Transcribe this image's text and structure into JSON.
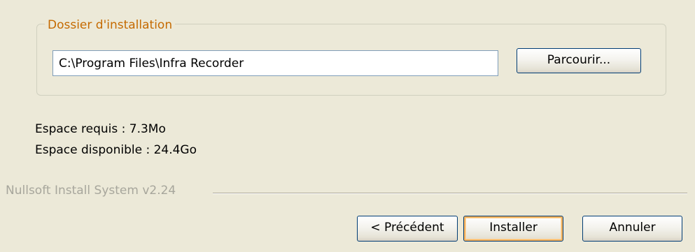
{
  "install_folder_group": {
    "label": "Dossier d'installation",
    "path_value": "C:\\Program Files\\Infra Recorder",
    "browse_label": "Parcourir..."
  },
  "space_info": {
    "required": "Espace requis : 7.3Mo",
    "available": "Espace disponible : 24.4Go"
  },
  "branding": {
    "text": "Nullsoft Install System v2.24"
  },
  "buttons": {
    "back_label": "< Précédent",
    "install_label": "Installer",
    "cancel_label": "Annuler"
  },
  "colors": {
    "background": "#ECE9D8",
    "group_label": "#C56A00",
    "branding_text": "#A7A69C",
    "button_border": "#003C74",
    "default_button_focus": "#F8B25B"
  }
}
